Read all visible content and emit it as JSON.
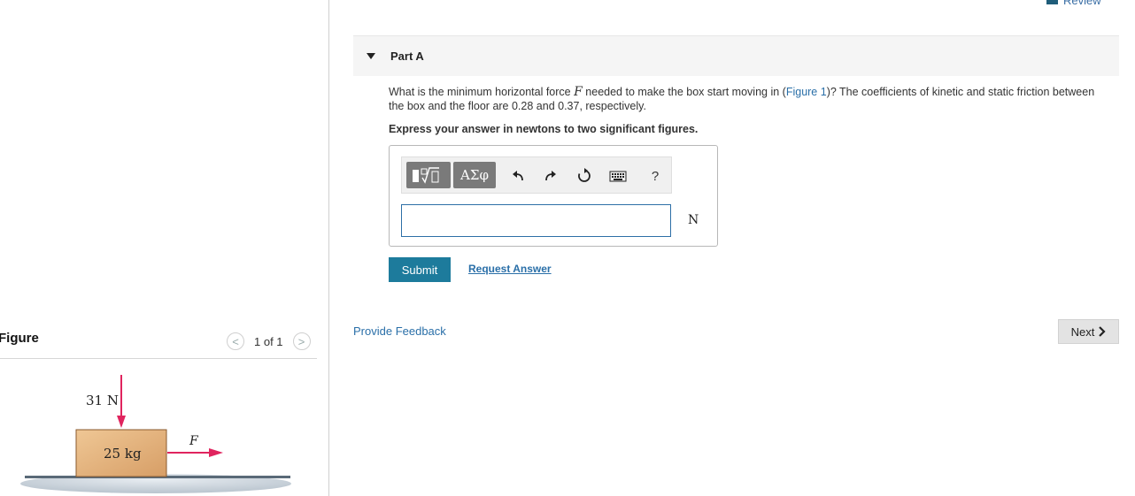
{
  "header": {
    "review_label": "Review"
  },
  "part": {
    "title": "Part A"
  },
  "question": {
    "text_before": "What is the minimum horizontal force ",
    "variable": "F",
    "text_middle": " needed to make the box start moving in (",
    "figure_link": "Figure 1",
    "text_after": ")? The coefficients of kinetic and static friction between the box and the floor are 0.28 and 0.37, respectively."
  },
  "instructions": "Express your answer in newtons to two significant figures.",
  "toolbar": {
    "greek_label": "ΑΣφ",
    "help_label": "?"
  },
  "answer": {
    "value": "",
    "unit": "N"
  },
  "actions": {
    "submit_label": "Submit",
    "request_answer_label": "Request Answer",
    "feedback_label": "Provide Feedback",
    "next_label": "Next"
  },
  "figure": {
    "title": "Figure",
    "pager_text": "1 of 1",
    "prev_symbol": "<",
    "next_symbol": ">",
    "force_label": "31 N",
    "mass_label": "25 kg",
    "applied_force_label": "F"
  },
  "colors": {
    "accent": "#1d7b9c",
    "link": "#2a6fa8",
    "arrow": "#e0245e",
    "box": "#e2b07e"
  }
}
